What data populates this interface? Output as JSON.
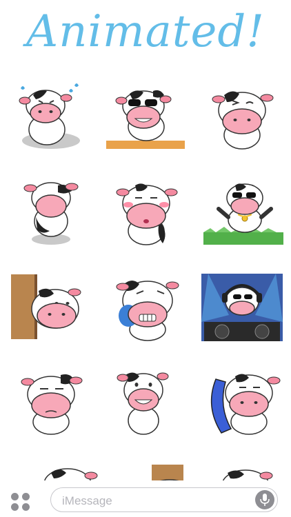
{
  "title": "Animated!",
  "stickers": [
    {
      "name": "cow-crying-sweat",
      "pose": "sweat"
    },
    {
      "name": "cow-sunglasses-ledge",
      "pose": "sunglasses"
    },
    {
      "name": "cow-wink",
      "pose": "wink"
    },
    {
      "name": "cow-from-behind",
      "pose": "back"
    },
    {
      "name": "cow-blushing",
      "pose": "blush"
    },
    {
      "name": "cow-money-rain",
      "pose": "money"
    },
    {
      "name": "cow-peeking-door",
      "pose": "peek"
    },
    {
      "name": "cow-crying-tears",
      "pose": "cry"
    },
    {
      "name": "cow-dj",
      "pose": "dj"
    },
    {
      "name": "cow-annoyed",
      "pose": "annoyed"
    },
    {
      "name": "cow-grinning",
      "pose": "grin"
    },
    {
      "name": "cow-phone-call",
      "pose": "phone"
    }
  ],
  "compose": {
    "placeholder": "iMessage",
    "apps_icon": "app-grid-icon",
    "mic_icon": "microphone-icon"
  },
  "colors": {
    "title": "#63bde8",
    "cow_nose": "#f7a8b8",
    "cow_spot": "#222222",
    "ears": "#f48aa0"
  }
}
